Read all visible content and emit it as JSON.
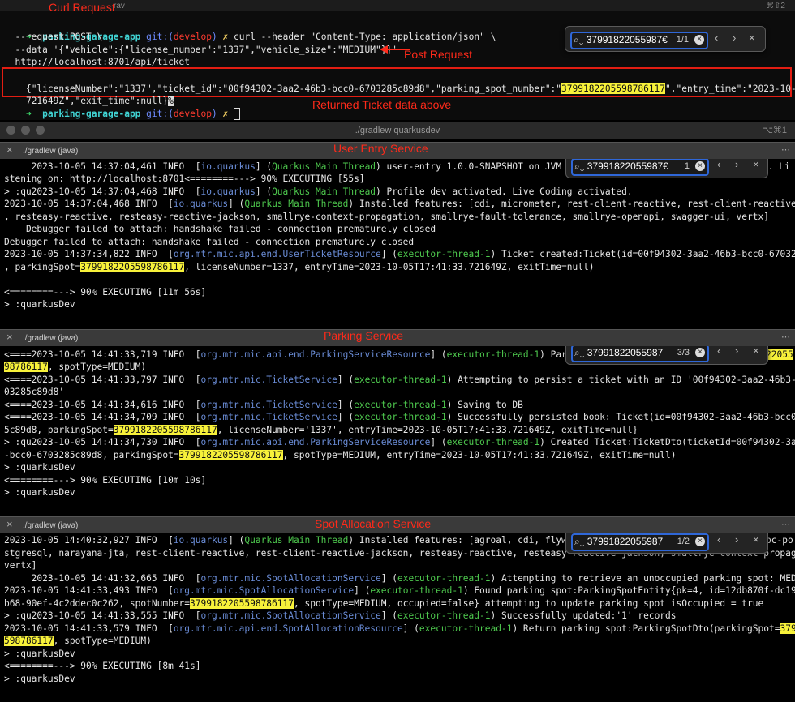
{
  "top": {
    "window_title_partial": "rav",
    "shortcut": "⌘⇧2",
    "label_curl": "Curl Request",
    "label_post": "Post Request",
    "label_returned": "Returned Ticket data above",
    "prompt_dir": "parking-garage-app",
    "git_label": "git:(",
    "git_branch": "develop",
    "git_close": ")",
    "x_mark": "✗",
    "cmd1": " curl --header \"Content-Type: application/json\" \\",
    "cmd2": "  --request POST \\",
    "cmd3": "  --data '{\"vehicle\":{\"license_number\":\"1337\",\"vehicle_size\":\"MEDIUM\"}}'",
    "cmd4": "  http://localhost:8701/api/ticket",
    "resp1_a": "{\"licenseNumber\":\"1337\",\"ticket_id\":\"00f94302-3aa2-46b3-bcc0-6703285c89d8\",\"parking_spot_number\":\"",
    "resp1_hl": "3799182205598786117",
    "resp1_b": "\",\"entry_time\":\"2023-10-05T17:41:33.",
    "resp2": "721649Z\",\"exit_time\":null}",
    "resp_cursor": "%",
    "search": {
      "query": "37991822055987€",
      "count": "1/1"
    }
  },
  "main_window": {
    "title": "./gradlew quarkusdev",
    "shortcut": "⌥⌘1"
  },
  "pane1": {
    "tab": "./gradlew (java)",
    "label": "User Entry Service",
    "search": {
      "query": "37991822055987€",
      "count": "1"
    },
    "lines": {
      "l1_a": "     2023-10-05 14:37:04,461 INFO  [",
      "l1_tag": "io.quarkus",
      "l1_b": "] (",
      "l1_thread": "Quarkus Main Thread",
      "l1_c": ") user-entry 1.0.0-SNAPSHOT on JVM (powe",
      "l1_end": "s. Li",
      "l2": "stening on: http://localhost:8701<========---> 90% EXECUTING [55s]",
      "l3_a": "> :qu2023-10-05 14:37:04,468 INFO  [",
      "l3_c": ") Profile dev activated. Live Coding activated.",
      "l4_a": "2023-10-05 14:37:04,468 INFO  [",
      "l4_c": ") Installed features: [cdi, micrometer, rest-client-reactive, rest-client-reactive-jackson",
      "l5": ", resteasy-reactive, resteasy-reactive-jackson, smallrye-context-propagation, smallrye-fault-tolerance, smallrye-openapi, swagger-ui, vertx]",
      "l6": "    Debugger failed to attach: handshake failed - connection prematurely closed",
      "l7": "Debugger failed to attach: handshake failed - connection prematurely closed",
      "l8_a": "2023-10-05 14:37:34,822 INFO  [",
      "l8_tag": "org.mtr.mic.api.end.UserTicketResource",
      "l8_thread": "executor-thread-1",
      "l8_c": ") Ticket created:Ticket(id=00f94302-3aa2-46b3-bcc0-6703285c89d8",
      "l9_a": ", parkingSpot=",
      "l9_b": ", licenseNumber=1337, entryTime=2023-10-05T17:41:33.721649Z, exitTime=null)",
      "l10": "<========---> 90% EXECUTING [11m 56s]",
      "l11": "> :quarkusDev"
    }
  },
  "pane2": {
    "tab": "./gradlew (java)",
    "label": "Parking Service",
    "search": {
      "query": "37991822055987",
      "count": "3/3"
    },
    "lines": {
      "l1_a": "<====2023-10-05 14:41:33,719 INFO  [",
      "l1_tag": "org.mtr.mic.api.end.ParkingServiceResource",
      "l1_c": ") ParkingA",
      "l1_end": "22055",
      "l2_hl": "98786117",
      "l2_b": ", spotType=MEDIUM)",
      "l3_a": "<====2023-10-05 14:41:33,797 INFO  [",
      "l3_tag": "org.mtr.mic.TicketService",
      "l3_c": ") Attempting to persist a ticket with an ID '00f94302-3aa2-46b3-bcc0-67",
      "l4": "03285c89d8'",
      "l5_a": "<====2023-10-05 14:41:34,616 INFO  [",
      "l5_c": ") Saving to DB",
      "l6_a": "<====2023-10-05 14:41:34,709 INFO  [",
      "l6_c": ") Successfully persisted book: Ticket(id=00f94302-3aa2-46b3-bcc0-670328",
      "l7_a": "5c89d8, parkingSpot=",
      "l7_b": ", licenseNumber='1337', entryTime=2023-10-05T17:41:33.721649Z, exitTime=null}",
      "l8_a": "> :qu2023-10-05 14:41:34,730 INFO  [",
      "l8_c": ") Created Ticket:TicketDto(ticketId=00f94302-3aa2-46b3",
      "l9_a": "-bcc0-6703285c89d8, parkingSpot=",
      "l9_b": ", spotType=MEDIUM, entryTime=2023-10-05T17:41:33.721649Z, exitTime=null)",
      "l10": "> :quarkusDev",
      "l11": "<========---> 90% EXECUTING [10m 10s]",
      "l12": "> :quarkusDev"
    }
  },
  "pane3": {
    "tab": "./gradlew (java)",
    "label": "Spot Allocation Service",
    "search": {
      "query": "37991822055987",
      "count": "1/2"
    },
    "lines": {
      "l1_a": "2023-10-05 14:40:32,927 INFO  [",
      "l1_c": ") Installed features: [agroal, cdi, flyway, ht",
      "l1_end": "bc-po",
      "l2": "stgresql, narayana-jta, rest-client-reactive, rest-client-reactive-jackson, resteasy-reactive, resteasy-reactive-jackson, smallrye-context-propagation,",
      "l3": "vertx]",
      "l4_a": "     2023-10-05 14:41:32,665 INFO  [",
      "l4_tag": "org.mtr.mic.SpotAllocationService",
      "l4_c": ") Attempting to retrieve an unoccupied parking spot: MEDIUM",
      "l5_a": "2023-10-05 14:41:33,493 INFO  [",
      "l5_c": ") Found parking spot:ParkingSpotEntity{pk=4, id=12db870f-dc19-4",
      "l6_a": "b68-90ef-4c2ddec0c262, spotNumber=",
      "l6_b": ", spotType=MEDIUM, occupied=false} attempting to update parking spot isOccupied = true",
      "l7_a": "> :qu2023-10-05 14:41:33,555 INFO  [",
      "l7_c": ") Successfully updated:'1' records",
      "l8_a": "2023-10-05 14:41:33,579 INFO  [",
      "l8_tag": "org.mtr.mic.api.end.SpotAllocationResource",
      "l8_c": ") Return parking spot:ParkingSpotDto(parkingSpot=",
      "l8_hl": "3799182205",
      "l9_hl": "598786117",
      "l9_b": ", spotType=MEDIUM)",
      "l10": "> :quarkusDev",
      "l11": "<========---> 90% EXECUTING [8m 41s]",
      "l12": "> :quarkusDev"
    }
  },
  "common": {
    "spot": "3799182205598786117",
    "thread_exec": "executor-thread-1",
    "tag_quarkus": "io.quarkus",
    "thread_main": "Quarkus Main Thread",
    "close_paren": ") ",
    "open_paren": "] ("
  }
}
